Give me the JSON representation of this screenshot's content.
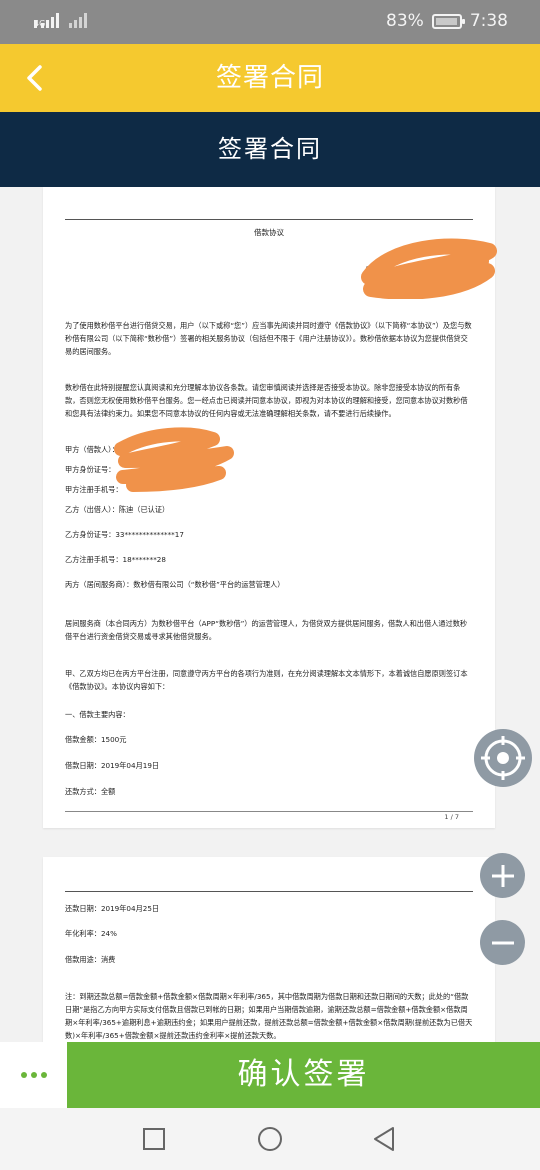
{
  "status_bar": {
    "signal1_tag": "4G",
    "battery": "83%",
    "time": "7:38"
  },
  "app_bar": {
    "title": "签署合同",
    "back_icon": "chevron-left-icon"
  },
  "doc_header": {
    "title": "签署合同"
  },
  "page1": {
    "title": "借款协议",
    "intro": "为了使用数秒借平台进行借贷交易，用户（以下或称“您”）应当事先阅读并同时遵守《借款协议》（以下简称“本协议”）及您与数秒借有限公司（以下简称“数秒借”）签署的相关服务协议（包括但不限于《用户注册协议》）。数秒借依据本协议为您提供借贷交易的居间服务。",
    "notice": "数秒借在此特别提醒您认真阅读和充分理解本协议各条款。请您审慎阅读并选择是否接受本协议。除非您接受本协议的所有条款，否则您无权使用数秒借平台服务。您一经点击已阅读并同意本协议，即视为对本协议的理解和接受，您同意本协议对数秒借和您具有法律约束力。如果您不同意本协议的任何内容或无法准确理解相关条款，请不要进行后续操作。",
    "party_a": "甲方（借款人）：",
    "party_a_id": "甲方身份证号：",
    "party_a_phone": "甲方注册手机号：",
    "party_b": "乙方（出借人）：陈迪（已认证）",
    "party_b_id": "乙方身份证号：33**************17",
    "party_b_phone": "乙方注册手机号：18*******28",
    "party_c": "丙方（居间服务商）：数秒借有限公司（“数秒借”平台的运营管理人）",
    "service_desc": "居间服务商（本合同丙方）为数秒借平台（APP“数秒借”）的运营管理人，为借贷双方提供居间服务，借款人和出借人通过数秒借平台进行资金借贷交易或寻求其他借贷服务。",
    "agreement_basis": "甲、乙双方均已在丙方平台注册，同意遵守丙方平台的各项行为准则，在充分阅读理解本文本情形下，本着诚信自愿原则签订本《借款协议》。本协议内容如下：",
    "section1": "一、借款主要内容：",
    "amount": "借款金额：1500元",
    "date": "借款日期：2019年04月19日",
    "repay_method": "还款方式：全额",
    "page_num": "1 / 7",
    "fragment_th": "th"
  },
  "page2": {
    "repay_date": "还款日期：2019年04月25日",
    "rate": "年化利率：24%",
    "purpose": "借款用途：消费",
    "note": "注：到期还款总额=借款金额+借款金额×借款周期×年利率/365，其中借款周期为借款日期和还款日期间的天数；此处的“借款日期”是指乙方向甲方实际支付借款且借款已到帐的日期；如果用户当期借款逾期，逾期还款总额=借款金额+借款金额×借款周期×年利率/365+逾期利息+逾期违约金；如果用户提前还款，提前还款总额=借款金额+借款金额×借款周期(提前还款为已借天数)×年利率/365+借款金额×提前还款违约金利率×提前还款天数。"
  },
  "fabs": {
    "locate_icon": "crosshair-icon",
    "zoom_in_icon": "plus-icon",
    "zoom_out_icon": "minus-icon"
  },
  "bottom_bar": {
    "more_icon": "more-dots-icon",
    "confirm_label": "确认签署"
  },
  "nav_bar": {
    "recent_icon": "square-icon",
    "home_icon": "circle-icon",
    "back_icon": "triangle-back-icon"
  },
  "colors": {
    "status_bar": "#8a8a8a",
    "app_bar": "#f5c92f",
    "doc_header": "#0e2a45",
    "confirm": "#6ab63a",
    "redaction": "#f0924a",
    "fab": "#8f9aa4"
  }
}
